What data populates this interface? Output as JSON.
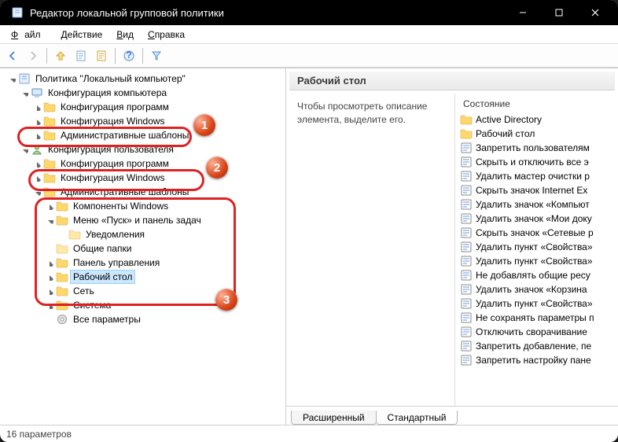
{
  "window": {
    "title": "Редактор локальной групповой политики"
  },
  "menu": {
    "file": "Файл",
    "action": "Действие",
    "view": "Вид",
    "help": "Справка"
  },
  "tree": {
    "root": "Политика \"Локальный компьютер\"",
    "comp_cfg": "Конфигурация компьютера",
    "soft_cfg": "Конфигурация программ",
    "win_cfg": "Конфигурация Windows",
    "adm_tpl": "Административные шаблоны",
    "user_cfg": "Конфигурация пользователя",
    "u_soft": "Конфигурация программ",
    "u_win": "Конфигурация Windows",
    "u_adm": "Административные шаблоны",
    "win_comp": "Компоненты Windows",
    "start_menu": "Меню «Пуск» и панель задач",
    "notif": "Уведомления",
    "shared": "Общие папки",
    "cpanel": "Панель управления",
    "desktop": "Рабочий стол",
    "network": "Сеть",
    "system": "Система",
    "all_params": "Все параметры"
  },
  "right": {
    "header": "Рабочий стол",
    "desc": "Чтобы просмотреть описание элемента, выделите его.",
    "state": "Состояние",
    "items": [
      {
        "t": "folder",
        "label": "Active Directory"
      },
      {
        "t": "folder",
        "label": "Рабочий стол"
      },
      {
        "t": "setting",
        "label": "Запретить пользователям"
      },
      {
        "t": "setting",
        "label": "Скрыть и отключить все э"
      },
      {
        "t": "setting",
        "label": "Удалить мастер очистки р"
      },
      {
        "t": "setting",
        "label": "Скрыть значок Internet Ex"
      },
      {
        "t": "setting",
        "label": "Удалить значок «Компьют"
      },
      {
        "t": "setting",
        "label": "Удалить значок «Мои доку"
      },
      {
        "t": "setting",
        "label": "Скрыть значок «Сетевые р"
      },
      {
        "t": "setting",
        "label": "Удалить пункт «Свойства»"
      },
      {
        "t": "setting",
        "label": "Удалить пункт «Свойства»"
      },
      {
        "t": "setting",
        "label": "Не добавлять общие ресу"
      },
      {
        "t": "setting",
        "label": "Удалить значок «Корзина"
      },
      {
        "t": "setting",
        "label": "Удалить пункт «Свойства»"
      },
      {
        "t": "setting",
        "label": "Не сохранять параметры п"
      },
      {
        "t": "setting",
        "label": "Отключить сворачивание"
      },
      {
        "t": "setting",
        "label": "Запретить добавление, пе"
      },
      {
        "t": "setting",
        "label": "Запретить настройку пане"
      }
    ]
  },
  "tabs": {
    "ext": "Расширенный",
    "std": "Стандартный"
  },
  "status": "16 параметров"
}
